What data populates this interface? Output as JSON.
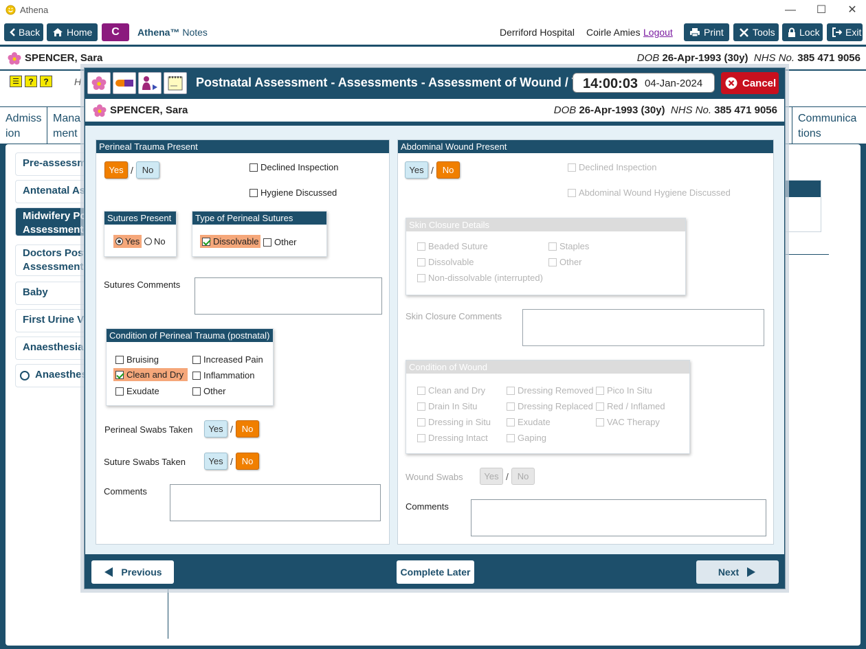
{
  "window": {
    "title": "Athena"
  },
  "toolbar": {
    "back": "Back",
    "home": "Home",
    "c_badge": "C",
    "app_name": "Athena™",
    "app_suffix": "Notes",
    "hospital": "Derriford Hospital",
    "user": "Coirle Amies",
    "logout": "Logout",
    "print": "Print",
    "tools": "Tools",
    "lock": "Lock",
    "exit": "Exit"
  },
  "patient": {
    "name": "SPENCER, Sara",
    "dob_label": "DOB",
    "dob": "26-Apr-1993 (30y)",
    "nhs_label": "NHS No.",
    "nhs": "385 471 9056"
  },
  "background": {
    "h_letter": "H",
    "tabs": [
      "Admiss ion",
      "Mana ment",
      "Communica tions"
    ],
    "sidebar": [
      "Pre-assessmen",
      "Antenatal Ass",
      "Midwifery Pos Assessments",
      "Doctors Postn Assessments",
      "Baby",
      "First Urine Voi",
      "Anaesthesia In",
      "Anaesthesia"
    ]
  },
  "modal": {
    "title": "Postnatal Assessment - Assessments - Assessment of Wound / Trauma",
    "time": "14:00:03",
    "date": "04-Jan-2024",
    "cancel": "Cancel",
    "perineal": {
      "header": "Perineal Trauma Present",
      "yes": "Yes",
      "no": "No",
      "slash": "/",
      "declined": "Declined Inspection",
      "hygiene": "Hygiene Discussed",
      "sutures_present": {
        "header": "Sutures Present",
        "yes": "Yes",
        "no": "No"
      },
      "suture_type": {
        "header": "Type of Perineal Sutures",
        "dissolvable": "Dissolvable",
        "other": "Other"
      },
      "sutures_comments": "Sutures Comments",
      "condition": {
        "header": "Condition of Perineal Trauma (postnatal)",
        "bruising": "Bruising",
        "increased_pain": "Increased Pain",
        "clean_dry": "Clean and Dry",
        "inflammation": "Inflammation",
        "exudate": "Exudate",
        "other": "Other"
      },
      "swabs_label": "Perineal Swabs Taken",
      "suture_swabs_label": "Suture Swabs Taken",
      "comments": "Comments"
    },
    "abdominal": {
      "header": "Abdominal Wound Present",
      "yes": "Yes",
      "no": "No",
      "slash": "/",
      "declined": "Declined Inspection",
      "hygiene": "Abdominal Wound Hygiene Discussed",
      "skin": {
        "header": "Skin Closure Details",
        "beaded": "Beaded Suture",
        "staples": "Staples",
        "dissolvable": "Dissolvable",
        "other": "Other",
        "nondissolvable": "Non-dissolvable (interrupted)"
      },
      "skin_comments": "Skin Closure Comments",
      "wound": {
        "header": "Condition of Wound",
        "clean_dry": "Clean and Dry",
        "dressing_removed": "Dressing Removed",
        "pico": "Pico In Situ",
        "drain": "Drain In Situ",
        "dressing_replaced": "Dressing Replaced",
        "red": "Red / Inflamed",
        "dressing_situ": "Dressing in Situ",
        "exudate": "Exudate",
        "vac": "VAC Therapy",
        "dressing_intact": "Dressing Intact",
        "gaping": "Gaping"
      },
      "swabs_label": "Wound Swabs",
      "comments": "Comments"
    },
    "footer": {
      "previous": "Previous",
      "complete_later": "Complete Later",
      "next": "Next"
    }
  },
  "colors": {
    "primary": "#1d4f6b",
    "accent": "#f07f00",
    "cancel": "#c8101e",
    "highlight": "#f5a77a"
  }
}
